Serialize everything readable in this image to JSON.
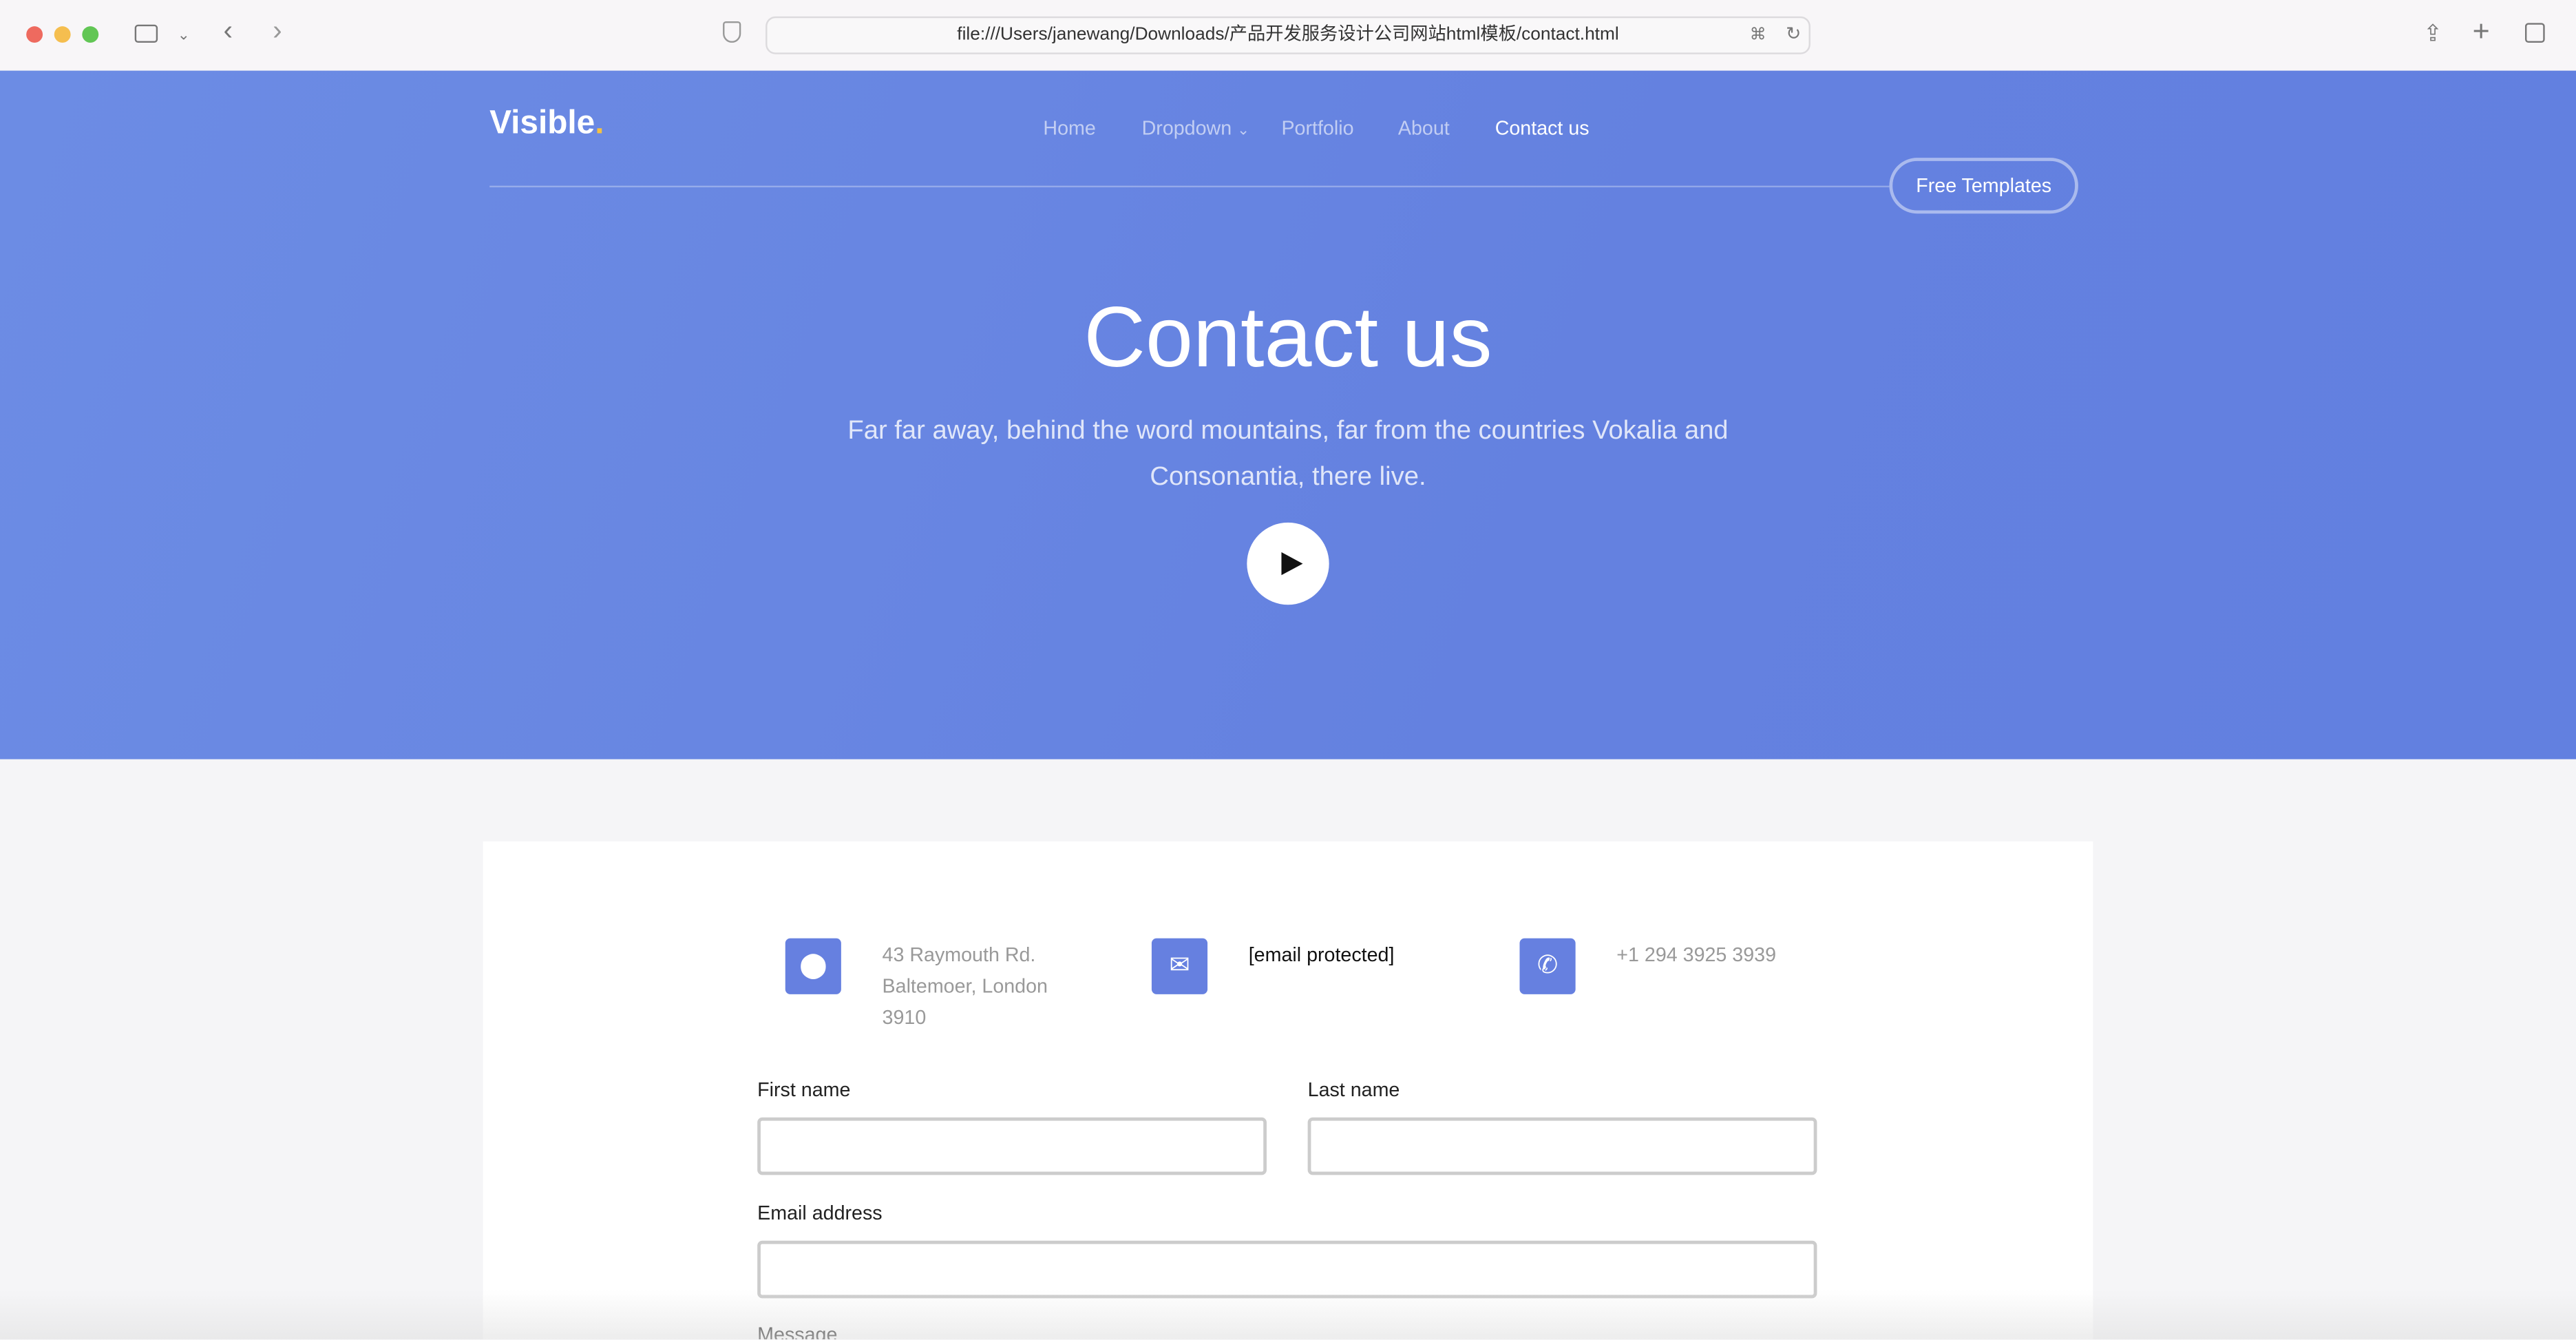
{
  "browser": {
    "url": "file:///Users/janewang/Downloads/产品开发服务设计公司网站html模板/contact.html"
  },
  "nav": {
    "logo": "Visible",
    "logo_dot": ".",
    "items": [
      {
        "label": "Home"
      },
      {
        "label": "Dropdown"
      },
      {
        "label": "Portfolio"
      },
      {
        "label": "About"
      },
      {
        "label": "Contact us"
      }
    ],
    "cta": "Free Templates"
  },
  "hero": {
    "title": "Contact us",
    "subtitle": "Far far away, behind the word mountains, far from the countries Vokalia and Consonantia, there live."
  },
  "info": {
    "address_line1": "43 Raymouth Rd.",
    "address_line2": "Baltemoer, London",
    "address_line3": "3910",
    "email": "[email protected]",
    "phone": "+1 294 3925 3939"
  },
  "form": {
    "first_name_label": "First name",
    "last_name_label": "Last name",
    "email_label": "Email address",
    "message_label": "Message",
    "first_name_value": "",
    "last_name_value": "",
    "email_value": ""
  },
  "colors": {
    "accent": "#6680e0",
    "hero_bg": "#6481e0",
    "logo_dot": "#f5c242"
  }
}
